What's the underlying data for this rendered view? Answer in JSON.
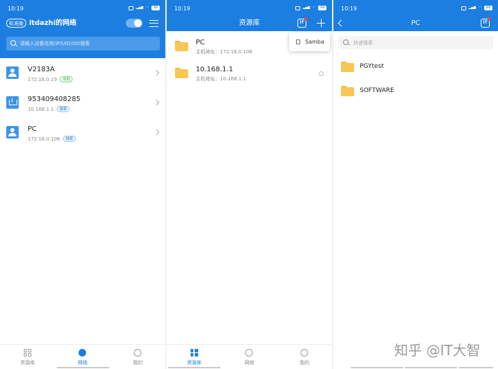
{
  "status_time": "10:19",
  "status_battery": "99",
  "screen1": {
    "edition_badge": "标准版",
    "title": "itdazhi的网络",
    "search_placeholder": "请输入设备名称/IP/UID/SID搜索",
    "devices": [
      {
        "name": "V2183A",
        "ip": "172.16.0.19",
        "tag": "本机",
        "tag_color": "#3bb14b"
      },
      {
        "name": "953409408285",
        "ip": "10.168.1.1",
        "tag": "独家",
        "tag_color": "#1b7ee0"
      },
      {
        "name": "PC",
        "ip": "172.16.0.106",
        "tag": "独家",
        "tag_color": "#1b7ee0"
      }
    ]
  },
  "screen2": {
    "title": "资源库",
    "brand_icon": "IT",
    "popup_label": "Samba",
    "items": [
      {
        "name": "PC",
        "address": "主机地址：172.16.0.106"
      },
      {
        "name": "10.168.1.1",
        "address": "主机地址：10.168.1.1"
      }
    ]
  },
  "screen3": {
    "title": "PC",
    "brand_icon": "IT",
    "search_placeholder": "快速搜索",
    "folders": [
      {
        "name": "PGYtest"
      },
      {
        "name": "SOFTWARE"
      }
    ]
  },
  "tabs": {
    "library": "资源库",
    "network": "网络",
    "me": "我的"
  },
  "watermark": "知乎 @IT大智",
  "colors": {
    "primary": "#1b7ee0",
    "folder": "#f8c654",
    "tag_green": "#3bb14b"
  }
}
